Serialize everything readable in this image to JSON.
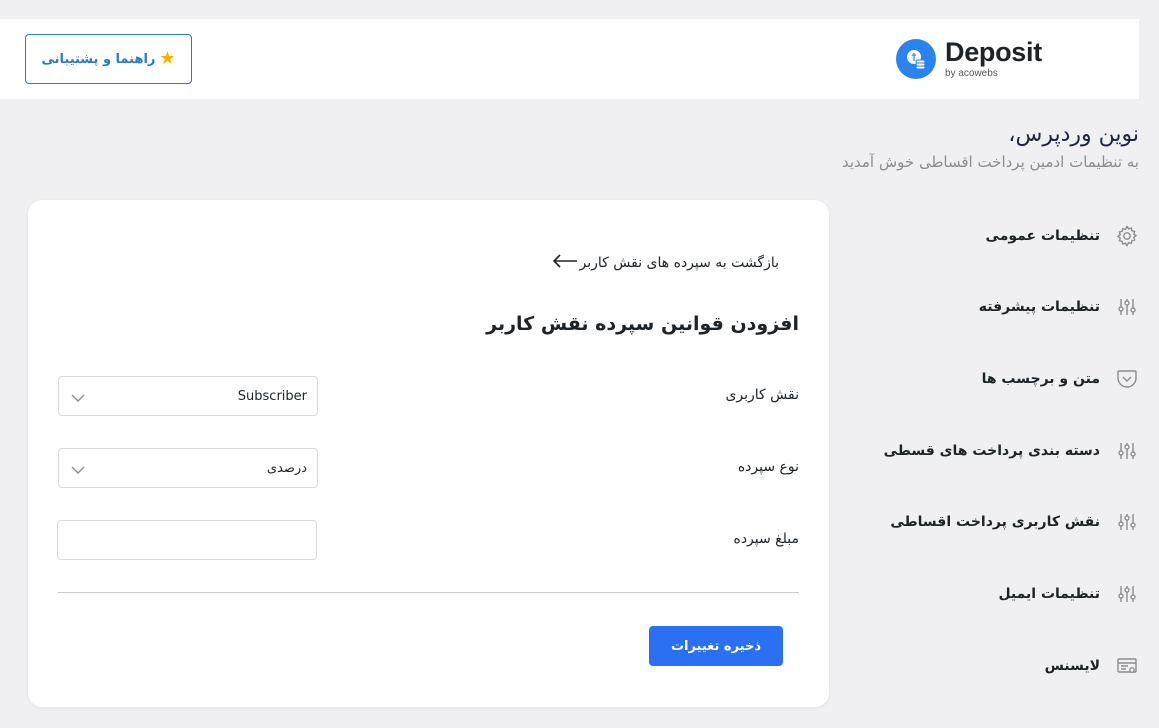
{
  "header": {
    "help_button_label": "راهنما و پشتیبانی",
    "logo_name": "Deposit",
    "logo_byline": "by acowebs"
  },
  "greeting": {
    "title": "نوین وردپرس،",
    "subtitle": "به تنظیمات ادمین پرداخت اقساطی خوش آمدید"
  },
  "sidebar": {
    "items": [
      {
        "label": "تنظیمات عمومی",
        "icon": "gear-icon"
      },
      {
        "label": "تنظیمات پیشرفته",
        "icon": "sliders-icon"
      },
      {
        "label": "متن و برچسب ها",
        "icon": "pocket-icon"
      },
      {
        "label": "دسته بندی پرداخت های قسطی",
        "icon": "sliders-icon"
      },
      {
        "label": "نقش کاربری پرداخت اقساطی",
        "icon": "sliders-icon"
      },
      {
        "label": "تنظیمات ایمیل",
        "icon": "sliders-icon"
      },
      {
        "label": "لایسنس",
        "icon": "license-icon"
      }
    ]
  },
  "form": {
    "back_link": "بازگشت به سپرده های نقش کاربر",
    "title": "افزودن قوانین سپرده نقش کاربر",
    "user_role_label": "نقش کاربری",
    "user_role_value": "Subscriber",
    "deposit_type_label": "نوع سپرده",
    "deposit_type_value": "درصدی",
    "deposit_amount_label": "مبلغ سپرده",
    "deposit_amount_value": "",
    "save_label": "ذخیره تغییرات"
  },
  "colors": {
    "accent": "#2b6ff2",
    "brand_blue": "#2b83ee",
    "help_border": "#2a79c9",
    "star": "#f5b400"
  }
}
